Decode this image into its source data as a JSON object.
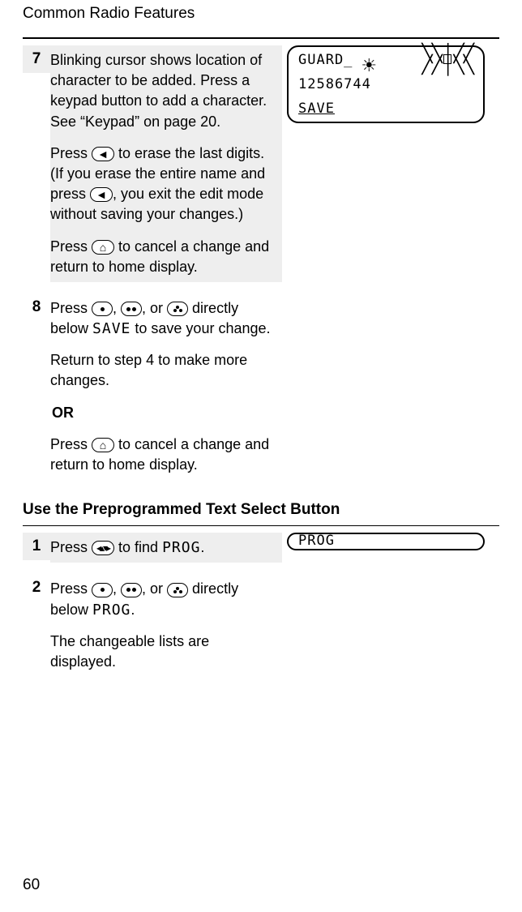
{
  "header": {
    "title": "Common Radio Features"
  },
  "lcd1": {
    "line1_label": "GUARD_",
    "line2_digits": "12586744",
    "line3_action": "SAVE"
  },
  "steps_main": {
    "s7": {
      "num": "7",
      "p1": "Blinking cursor shows location of character to be added. Press a keypad button to add a character. See “Keypad” on page 20.",
      "p2_a": "Press ",
      "p2_b": " to erase the last digits. (If you erase the entire name and press ",
      "p2_c": ", you exit the edit mode without saving your changes.)",
      "p3_a": "Press ",
      "p3_b": " to cancel a change and return to home display."
    },
    "s8": {
      "num": "8",
      "p1_a": "Press ",
      "p1_b": ", ",
      "p1_c": ", or ",
      "p1_d": " directly below ",
      "p1_save": "SAVE",
      "p1_e": " to save your change.",
      "p2": "Return to step 4 to make more changes.",
      "or": "OR",
      "p3_a": "Press ",
      "p3_b": " to cancel a change and return to home display."
    }
  },
  "section2": {
    "title": "Use the Preprogrammed Text Select Button"
  },
  "lcd2": {
    "label": "PROG"
  },
  "steps_sub": {
    "s1": {
      "num": "1",
      "a": "Press ",
      "b": "  to find ",
      "prog": "PROG",
      "c": "."
    },
    "s2": {
      "num": "2",
      "a": "Press ",
      "b": ", ",
      "c": ", or ",
      "d": " directly below ",
      "prog": "PROG",
      "e": ".",
      "p2": "The changeable lists are displayed."
    }
  },
  "footer": {
    "page": "60"
  }
}
